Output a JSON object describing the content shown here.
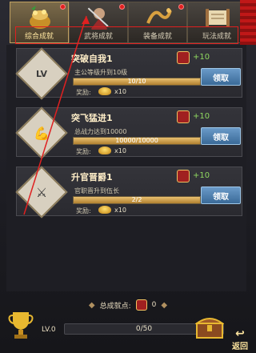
{
  "tabs": [
    {
      "label": "综合成就",
      "active": true,
      "badge": true
    },
    {
      "label": "武将成就",
      "active": false,
      "badge": true
    },
    {
      "label": "装备成就",
      "active": false,
      "badge": true
    },
    {
      "label": "玩法成就",
      "active": false,
      "badge": false
    }
  ],
  "achievements": [
    {
      "title": "突破自我1",
      "icon": "level-up-icon",
      "icon_glyph": "LV",
      "reward_points": "+10",
      "description": "主公等级升到10级",
      "progress_text": "10/10",
      "progress": 1.0,
      "reward_label": "奖励:",
      "reward_count": "x10",
      "claim_label": "领取"
    },
    {
      "title": "突飞猛进1",
      "icon": "strength-icon",
      "icon_glyph": "💪",
      "reward_points": "+10",
      "description": "总战力达到10000",
      "progress_text": "10000/10000",
      "progress": 1.0,
      "reward_label": "奖励:",
      "reward_count": "x10",
      "claim_label": "领取"
    },
    {
      "title": "升官晋爵1",
      "icon": "helmet-icon",
      "icon_glyph": "⚔",
      "reward_points": "+10",
      "description": "官职晋升到伍长",
      "progress_text": "2/2",
      "progress": 1.0,
      "reward_label": "奖励:",
      "reward_count": "x10",
      "claim_label": "领取"
    }
  ],
  "footer": {
    "points_label": "总成就点:",
    "points_value": "0",
    "level": "LV.0",
    "level_progress_text": "0/50",
    "level_progress": 0.0,
    "back_label": "返回"
  },
  "colors": {
    "accent_gold": "#e8c070",
    "claim_blue": "#3a6a98",
    "alert_red": "#e02020",
    "plus_green": "#8fd860"
  }
}
